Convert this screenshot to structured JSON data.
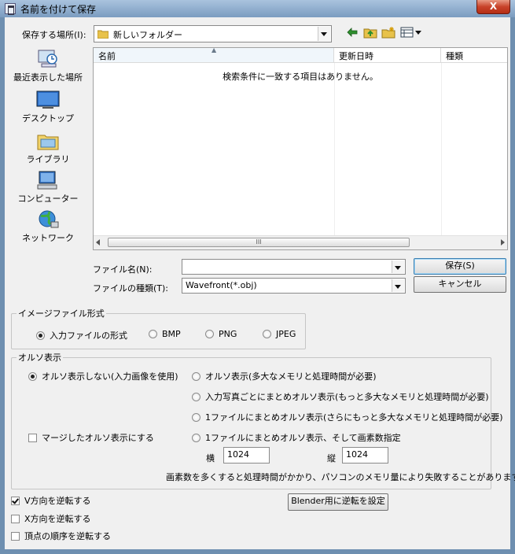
{
  "window": {
    "title": "名前を付けて保存",
    "close_glyph": "X"
  },
  "save_location": {
    "label": "保存する場所(I):",
    "value": "新しいフォルダー"
  },
  "places": [
    {
      "label": "最近表示した場所",
      "icon": "recent-places-icon"
    },
    {
      "label": "デスクトップ",
      "icon": "desktop-icon"
    },
    {
      "label": "ライブラリ",
      "icon": "libraries-icon"
    },
    {
      "label": "コンピューター",
      "icon": "computer-icon"
    },
    {
      "label": "ネットワーク",
      "icon": "network-icon"
    }
  ],
  "file_list": {
    "columns": [
      "名前",
      "更新日時",
      "種類"
    ],
    "empty_message": "検索条件に一致する項目はありません。",
    "scroll_grip": "III"
  },
  "file_name": {
    "label": "ファイル名(N):",
    "value": ""
  },
  "file_type": {
    "label": "ファイルの種類(T):",
    "value": "Wavefront(*.obj)"
  },
  "buttons": {
    "save": "保存(S)",
    "cancel": "キャンセル",
    "blender": "Blender用に逆転を設定"
  },
  "image_format": {
    "legend": "イメージファイル形式",
    "options": [
      "入力ファイルの形式",
      "BMP",
      "PNG",
      "JPEG"
    ],
    "selected": 0
  },
  "ortho": {
    "legend": "オルソ表示",
    "options": [
      "オルソ表示しない(入力画像を使用)",
      "オルソ表示(多大なメモリと処理時間が必要)",
      "入力写真ごとにまとめオルソ表示(もっと多大なメモリと処理時間が必要)",
      "1ファイルにまとめオルソ表示(さらにもっと多大なメモリと処理時間が必要)",
      "1ファイルにまとめオルソ表示、そして画素数指定"
    ],
    "selected": 0,
    "merge_label": "マージしたオルソ表示にする",
    "width_label": "横",
    "width_value": "1024",
    "height_label": "縦",
    "height_value": "1024",
    "note": "画素数を多くすると処理時間がかかり、パソコンのメモリ量により失敗することがあります。"
  },
  "checks": {
    "flip_v": "V方向を逆転する",
    "flip_x": "X方向を逆転する",
    "reverse_vertices": "頂点の順序を逆転する"
  },
  "colors": {
    "accent": "#3c7fb1",
    "window_frame": "#6e8fb0",
    "close_red": "#c8432a",
    "folder_yellow": "#e8c24a"
  }
}
